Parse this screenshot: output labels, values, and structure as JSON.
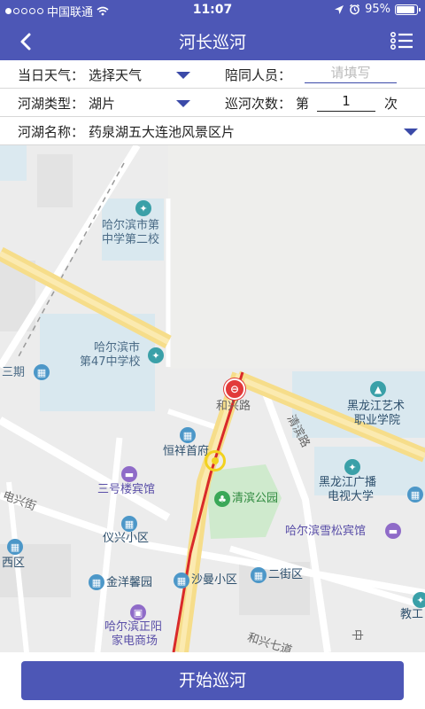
{
  "status_bar": {
    "carrier": "中国联通",
    "time": "11:07",
    "battery_text": "95%",
    "battery_level": 0.95,
    "signal_dots_filled": 1,
    "signal_dots_total": 5
  },
  "nav": {
    "title": "河长巡河",
    "back_icon": "chevron-left-icon",
    "menu_icon": "list-menu-icon"
  },
  "form": {
    "weather_label": "当日天气：",
    "weather_value": "选择天气",
    "companion_label": "陪同人员：",
    "companion_placeholder": "请填写",
    "lake_type_label": "河湖类型：",
    "lake_type_value": "湖片",
    "patrol_count_label": "巡河次数：",
    "patrol_count_prefix": "第",
    "patrol_count_value": "1",
    "patrol_count_suffix": "次",
    "lake_name_label": "河湖名称：",
    "lake_name_value": "药泉湖五大连池风景区片"
  },
  "map": {
    "labels": {
      "school2_line1": "哈尔滨市第",
      "school2_line2": "中学第二校",
      "school47_line1": "哈尔滨市",
      "school47_line2": "第47中学校",
      "sanqi": "三期",
      "hexing_road": "和兴路",
      "arts_line1": "黑龙江艺术",
      "arts_line2": "职业学院",
      "qingbin_road": "清滨路",
      "hengxiang": "恒祥首府",
      "sanhao_hotel": "三号楼宾馆",
      "qingbin_park": "清滨公园",
      "broadcast_line1": "黑龙江广播",
      "broadcast_line2": "电视大学",
      "dianxing_street": "电兴街",
      "snow_pine_hotel": "哈尔滨雪松宾馆",
      "yixing": "仪兴小区",
      "xiqu": "西区",
      "jinyang": "金洋馨园",
      "shaman": "沙曼小区",
      "erjie": "二街区",
      "zhengyang_line1": "哈尔滨正阳",
      "zhengyang_line2": "家电商场",
      "jiaogong": "教工",
      "hexing7": "和兴七道",
      "zhong": "中"
    }
  },
  "bottom": {
    "start_button": "开始巡河"
  },
  "colors": {
    "brand_blue": "#4d57b6",
    "route_red": "#d92a2a",
    "park_green": "#cfeacd",
    "road_yellow": "#f6dd8a"
  }
}
